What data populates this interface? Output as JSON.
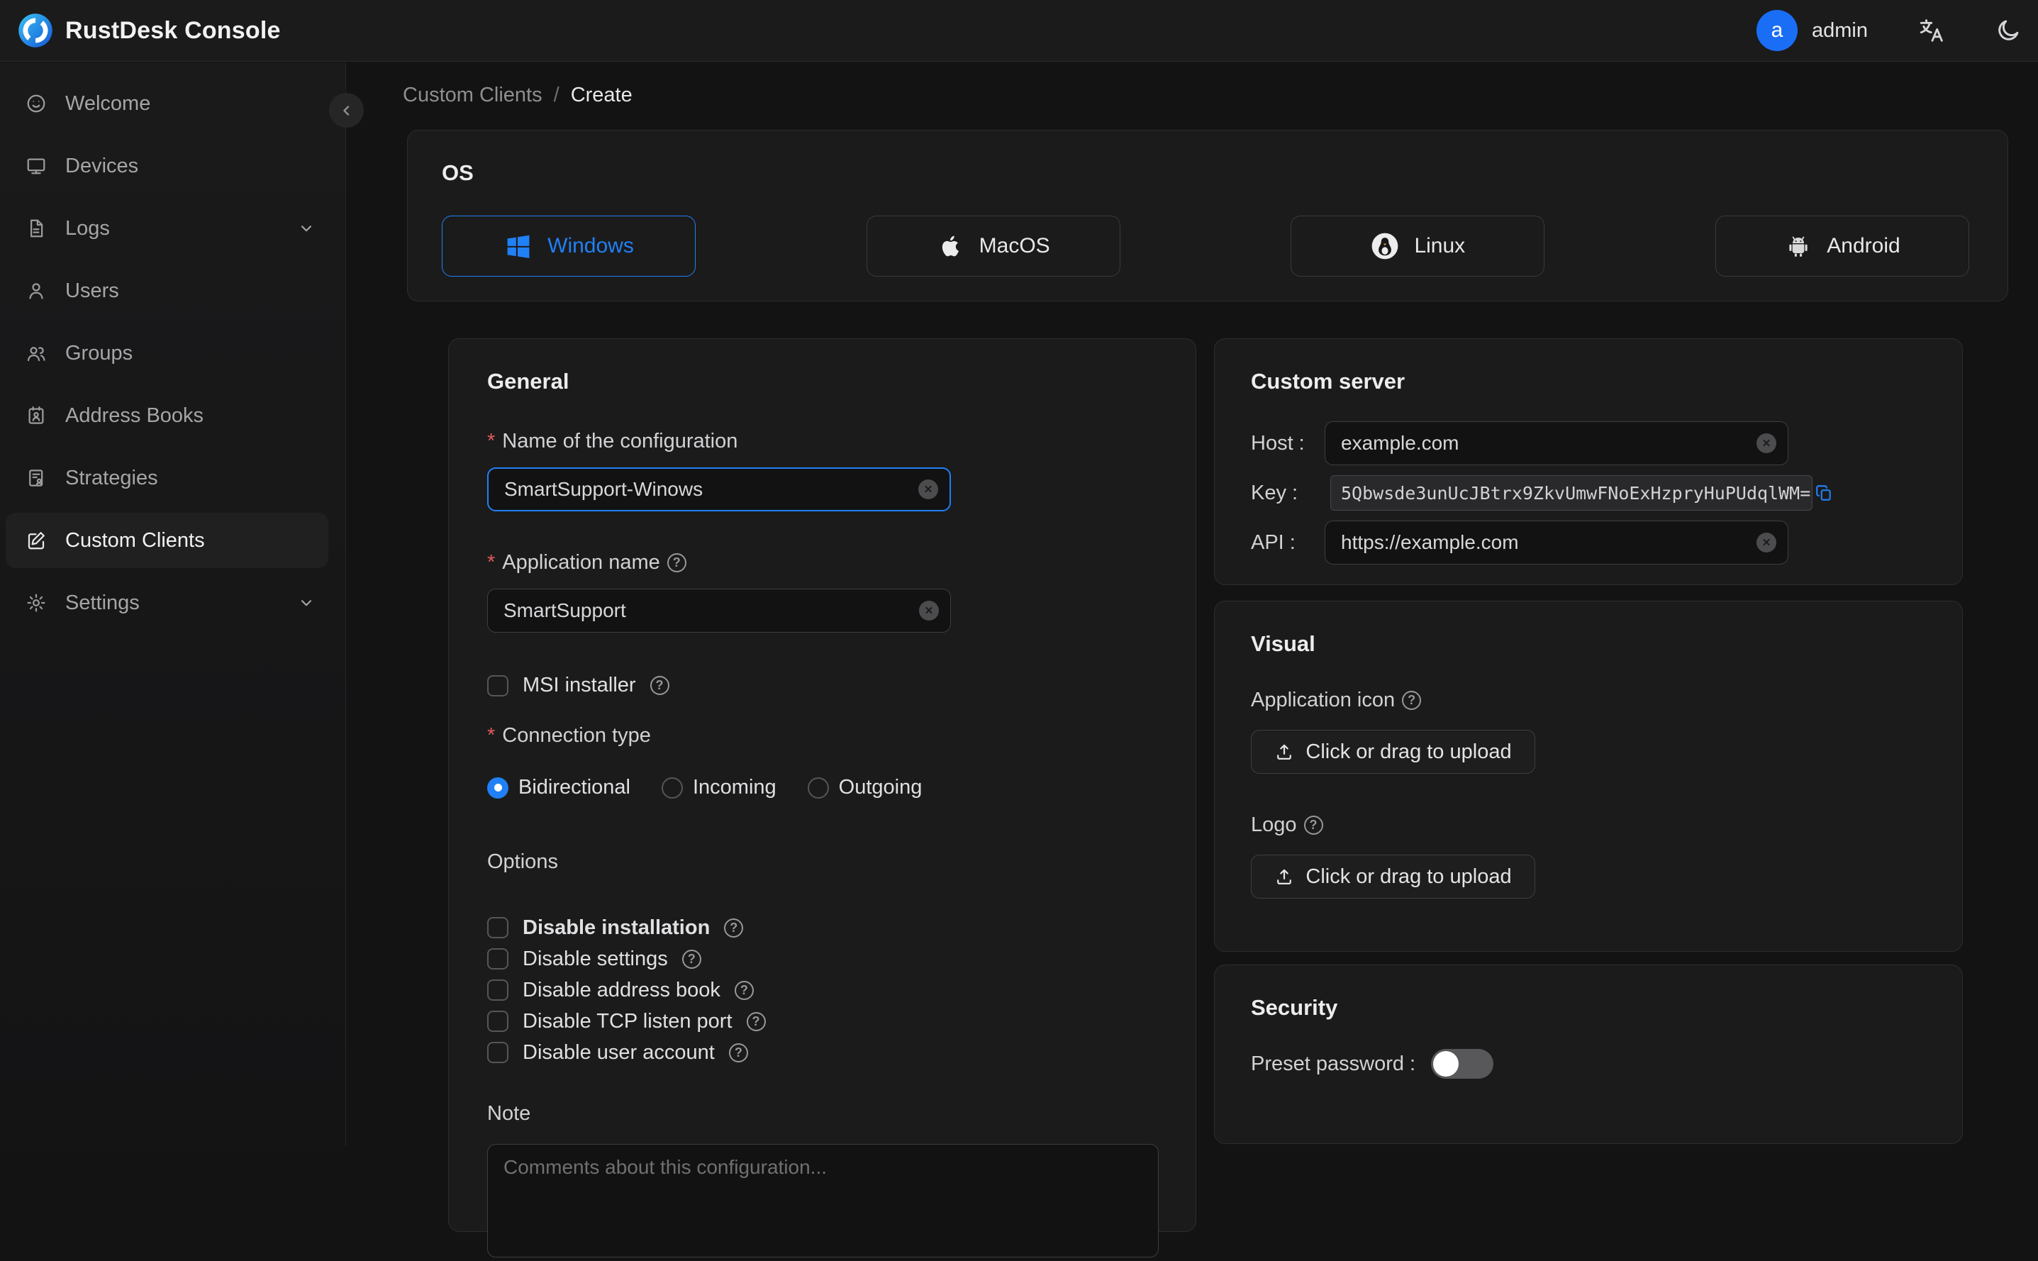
{
  "ui": {
    "required_marker": "*",
    "help_glyph": "?",
    "clear_glyph": "✕"
  },
  "app": {
    "title": "RustDesk Console"
  },
  "topbar": {
    "user": {
      "avatar_letter": "a",
      "name": "admin"
    }
  },
  "sidebar": {
    "items": [
      {
        "label": "Welcome",
        "icon": "smiley-icon",
        "active": false,
        "expandable": false
      },
      {
        "label": "Devices",
        "icon": "monitor-icon",
        "active": false,
        "expandable": false
      },
      {
        "label": "Logs",
        "icon": "document-icon",
        "active": false,
        "expandable": true
      },
      {
        "label": "Users",
        "icon": "user-icon",
        "active": false,
        "expandable": false
      },
      {
        "label": "Groups",
        "icon": "users-icon",
        "active": false,
        "expandable": false
      },
      {
        "label": "Address Books",
        "icon": "address-book-icon",
        "active": false,
        "expandable": false
      },
      {
        "label": "Strategies",
        "icon": "strategy-icon",
        "active": false,
        "expandable": false
      },
      {
        "label": "Custom Clients",
        "icon": "edit-square-icon",
        "active": true,
        "expandable": false
      },
      {
        "label": "Settings",
        "icon": "gear-icon",
        "active": false,
        "expandable": true
      }
    ]
  },
  "breadcrumb": {
    "parent": "Custom Clients",
    "separator": "/",
    "current": "Create"
  },
  "os_card": {
    "title": "OS",
    "options": [
      {
        "label": "Windows",
        "selected": true
      },
      {
        "label": "MacOS",
        "selected": false
      },
      {
        "label": "Linux",
        "selected": false
      },
      {
        "label": "Android",
        "selected": false
      }
    ]
  },
  "general_card": {
    "title": "General",
    "name_field": {
      "label": "Name of the configuration",
      "required": true,
      "value": "SmartSupport-Winows"
    },
    "app_name_field": {
      "label": "Application name",
      "required": true,
      "value": "SmartSupport"
    },
    "msi_checkbox": {
      "label": "MSI installer",
      "checked": false
    },
    "connection_type": {
      "label": "Connection type",
      "required": true,
      "options": [
        {
          "label": "Bidirectional",
          "selected": true
        },
        {
          "label": "Incoming",
          "selected": false
        },
        {
          "label": "Outgoing",
          "selected": false
        }
      ]
    },
    "options_section": {
      "label": "Options",
      "items": [
        {
          "label": "Disable installation",
          "bold": true,
          "checked": false
        },
        {
          "label": "Disable settings",
          "bold": false,
          "checked": false
        },
        {
          "label": "Disable address book",
          "bold": false,
          "checked": false
        },
        {
          "label": "Disable TCP listen port",
          "bold": false,
          "checked": false
        },
        {
          "label": "Disable user account",
          "bold": false,
          "checked": false
        }
      ]
    },
    "note": {
      "label": "Note",
      "placeholder": "Comments about this configuration..."
    }
  },
  "custom_server_card": {
    "title": "Custom server",
    "host": {
      "label": "Host :",
      "value": "example.com"
    },
    "key": {
      "label": "Key :",
      "value": "5Qbwsde3unUcJBtrx9ZkvUmwFNoExHzpryHuPUdqlWM="
    },
    "api": {
      "label": "API :",
      "value": "https://example.com"
    }
  },
  "visual_card": {
    "title": "Visual",
    "upload_button_label": "Click or drag to upload",
    "app_icon": {
      "label": "Application icon"
    },
    "logo": {
      "label": "Logo"
    }
  },
  "security_card": {
    "title": "Security",
    "preset_password": {
      "label": "Preset password :",
      "enabled": false
    }
  },
  "colors": {
    "accent_blue": "#2080f5",
    "avatar_blue": "#1a6ef5",
    "required_red": "#e25a5a",
    "card_bg": "#1b1b1c",
    "page_bg": "#131314"
  }
}
